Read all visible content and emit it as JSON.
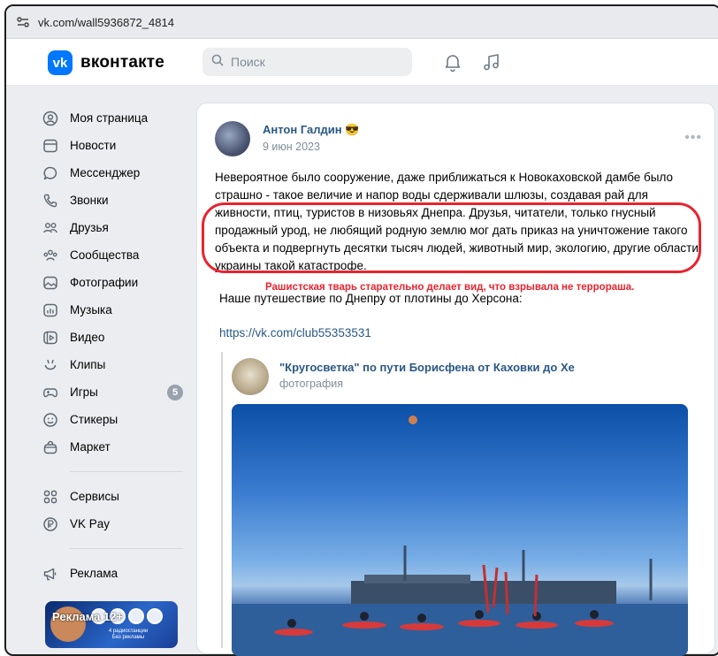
{
  "browser": {
    "url": "vk.com/wall5936872_4814"
  },
  "header": {
    "logo_mark": "vk",
    "logo_text": "вконтакте",
    "search_placeholder": "Поиск",
    "icons": [
      "bell-icon",
      "music-icon"
    ]
  },
  "sidebar": {
    "items": [
      {
        "label": "Моя страница",
        "icon": "profile-icon"
      },
      {
        "label": "Новости",
        "icon": "news-icon"
      },
      {
        "label": "Мессенджер",
        "icon": "messenger-icon"
      },
      {
        "label": "Звонки",
        "icon": "phone-icon"
      },
      {
        "label": "Друзья",
        "icon": "friends-icon"
      },
      {
        "label": "Сообщества",
        "icon": "communities-icon"
      },
      {
        "label": "Фотографии",
        "icon": "photos-icon"
      },
      {
        "label": "Музыка",
        "icon": "music-icon"
      },
      {
        "label": "Видео",
        "icon": "video-icon"
      },
      {
        "label": "Клипы",
        "icon": "clips-icon"
      },
      {
        "label": "Игры",
        "icon": "games-icon",
        "badge": "5"
      },
      {
        "label": "Стикеры",
        "icon": "stickers-icon"
      },
      {
        "label": "Маркет",
        "icon": "market-icon"
      }
    ],
    "extra_items": [
      {
        "label": "Сервисы",
        "icon": "services-icon"
      },
      {
        "label": "VK Pay",
        "icon": "vkpay-icon"
      }
    ],
    "ads_item": {
      "label": "Реклама",
      "icon": "ads-icon"
    },
    "ad_banner": {
      "label": "Реклама 12+",
      "small_text": "4 радиостанции\nБез рекламы"
    }
  },
  "post": {
    "author": "Антон Галдин 😎",
    "date": "9 июн 2023",
    "text": "Невероятное было сооружение, даже приближаться к Новокаховской дамбе было страшно - такое величие и напор воды сдерживали шлюзы, создавая рай для живности, птиц, туристов в низовьях Днепра. Друзья, читатели, только гнусный продажный урод, не любящий родную землю мог дать приказ на уничтожение такого объекта и подвергнуть десятки тысяч людей, животный мир, экологию, другие области украины такой катастрофе.",
    "annotation": "Рашистская тварь старательно делает вид, что взрывала не терроpаша.",
    "journey_text": "Наше путешествие по Днепру от плотины до Херсона:",
    "link": "https://vk.com/club55353531",
    "repost": {
      "title": "\"Кругосветка\" по пути Борисфена от Каховки до Хе",
      "subtitle": "фотография"
    }
  },
  "colors": {
    "accent": "#0077ff",
    "link": "#2a5885",
    "annotation_red": "#e8232f",
    "page_bg": "#ebedf0"
  }
}
